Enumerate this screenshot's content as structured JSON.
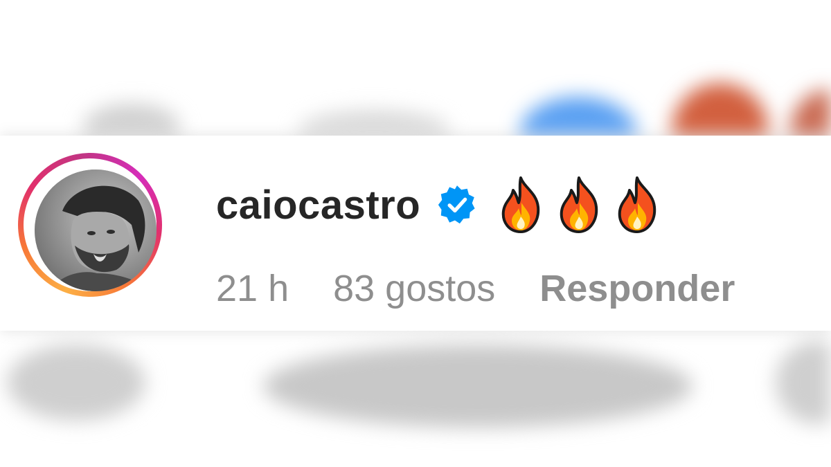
{
  "comment": {
    "username": "caiocastro",
    "verified": true,
    "text": "🔥🔥🔥",
    "time": "21 h",
    "likes": "83 gostos",
    "reply_label": "Responder"
  },
  "colors": {
    "username": "#262626",
    "meta": "#8e8e8e",
    "verified_badge": "#0095f6",
    "story_ring": [
      "#fcaf45",
      "#f77737",
      "#e1306c",
      "#c13584"
    ]
  },
  "icons": {
    "verified": "verified-badge-icon",
    "emoji": "fire-emoji"
  }
}
